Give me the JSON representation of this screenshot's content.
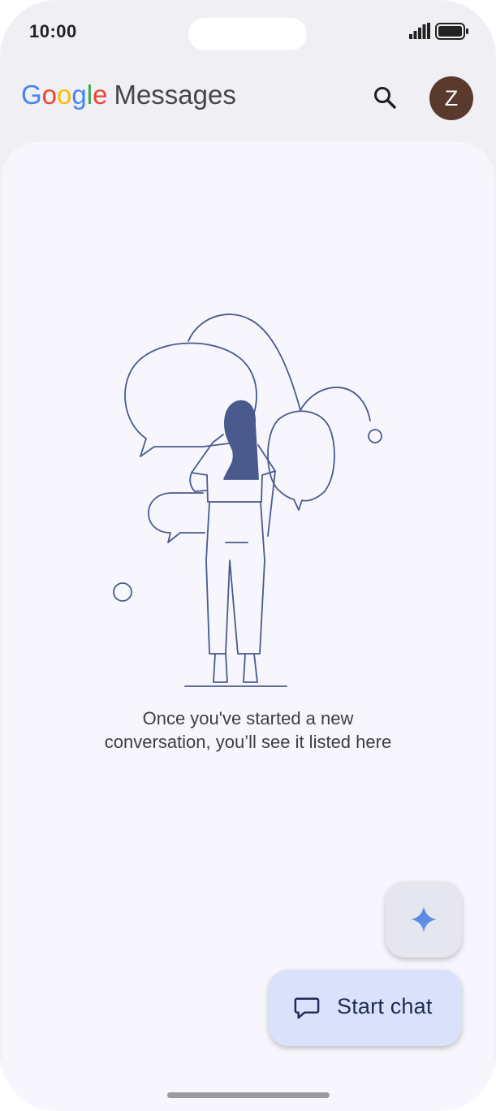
{
  "status_bar": {
    "time": "10:00"
  },
  "app_bar": {
    "logo_letters": [
      "G",
      "o",
      "o",
      "g",
      "l",
      "e"
    ],
    "logo_colors": [
      "#4285F4",
      "#EA4335",
      "#FBBC05",
      "#4285F4",
      "#34A853",
      "#EA4335"
    ],
    "title": "Messages",
    "search_icon": "search-icon",
    "avatar_initial": "Z",
    "avatar_color": "#5a3a2c"
  },
  "empty_state": {
    "line1": "Once you've started a new",
    "line2": "conversation, you’ll see it listed here"
  },
  "fab": {
    "gemini_icon": "sparkle-icon",
    "start_chat_label": "Start chat",
    "start_chat_icon": "chat-bubble-icon"
  },
  "colors": {
    "background": "#f7f6fc",
    "accent": "#d9e2fa",
    "illustration_stroke": "#4a5a8c"
  }
}
